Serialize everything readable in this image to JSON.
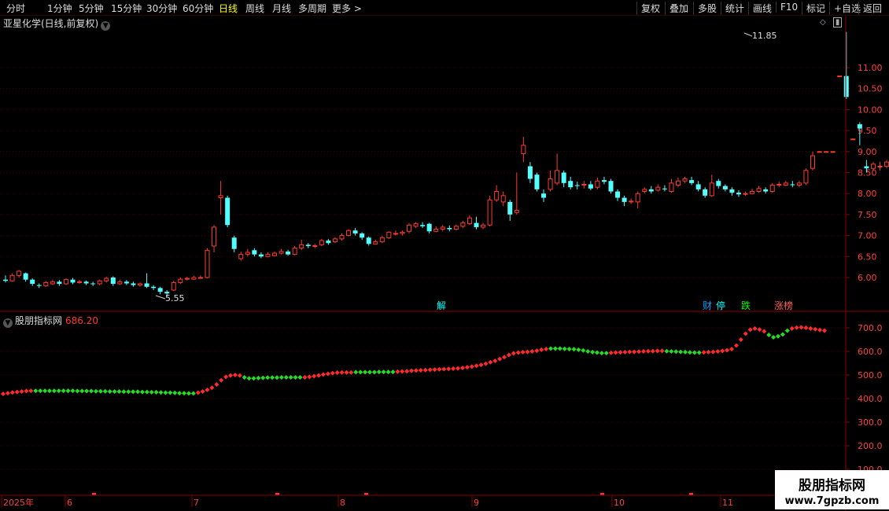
{
  "toolbar": {
    "periods": [
      "分时",
      "1分钟",
      "5分钟",
      "15分钟",
      "30分钟",
      "60分钟",
      "日线",
      "周线",
      "月线",
      "多周期",
      "更多 >"
    ],
    "active_period": "日线",
    "actions": [
      "复权",
      "叠加",
      "多股",
      "统计",
      "画线",
      "F10",
      "标记",
      "+自选",
      "返回"
    ]
  },
  "main_chart": {
    "title": "亚星化学(日线,前复权)",
    "high_label": "11.85",
    "low_label": "5.55",
    "y_ticks": [
      "11.00",
      "10.50",
      "10.00",
      "9.50",
      "9.00",
      "8.50",
      "8.00",
      "7.50",
      "7.00",
      "6.50",
      "6.00"
    ],
    "event_markers": [
      {
        "label": "解",
        "color": "#00ffff"
      },
      {
        "label": "财",
        "color": "#00a0ff"
      },
      {
        "label": "停",
        "color": "#00ffff"
      },
      {
        "label": "跌",
        "color": "#00ff00"
      },
      {
        "label": "涨榜",
        "color": "#ff6060"
      }
    ]
  },
  "indicator": {
    "title": "股朋指标网",
    "value": "686.20",
    "y_ticks": [
      "700.0",
      "600.0",
      "500.0",
      "400.0",
      "300.0",
      "200.0",
      "100.0"
    ]
  },
  "x_axis": {
    "labels": [
      "2025年",
      "6",
      "7",
      "8",
      "9",
      "10",
      "11"
    ]
  },
  "watermark": {
    "line1": "股朋指标网",
    "line2": "www.7gpzb.com"
  },
  "colors": {
    "up": "#ff3b30",
    "down": "#54ffff",
    "grid": "#4a0000",
    "axis": "#8b0000",
    "ind_up": "#ff2a2a",
    "ind_down": "#22dd22"
  },
  "chart_data": {
    "type": "candlestick",
    "ylim": [
      5.5,
      11.9
    ],
    "candles": [
      [
        5.95,
        5.92,
        6.05,
        5.88
      ],
      [
        5.92,
        6.05,
        6.1,
        5.9
      ],
      [
        6.05,
        6.15,
        6.18,
        6.0
      ],
      [
        6.1,
        5.95,
        6.12,
        5.9
      ],
      [
        5.95,
        5.85,
        5.98,
        5.8
      ],
      [
        5.82,
        5.8,
        5.86,
        5.75
      ],
      [
        5.8,
        5.88,
        5.92,
        5.78
      ],
      [
        5.85,
        5.9,
        5.95,
        5.82
      ],
      [
        5.9,
        5.85,
        5.94,
        5.8
      ],
      [
        5.85,
        5.95,
        5.98,
        5.82
      ],
      [
        5.95,
        5.88,
        5.99,
        5.84
      ],
      [
        5.88,
        5.9,
        5.94,
        5.85
      ],
      [
        5.9,
        5.86,
        5.93,
        5.82
      ],
      [
        5.86,
        5.85,
        5.9,
        5.8
      ],
      [
        5.85,
        5.92,
        5.95,
        5.82
      ],
      [
        5.92,
        5.98,
        6.02,
        5.88
      ],
      [
        6.0,
        5.85,
        6.03,
        5.8
      ],
      [
        5.85,
        5.9,
        5.95,
        5.82
      ],
      [
        5.9,
        5.86,
        5.94,
        5.82
      ],
      [
        5.86,
        5.82,
        5.9,
        5.78
      ],
      [
        5.82,
        5.85,
        5.88,
        5.78
      ],
      [
        5.86,
        5.78,
        6.1,
        5.75
      ],
      [
        5.78,
        5.75,
        5.82,
        5.7
      ],
      [
        5.75,
        5.66,
        5.78,
        5.6
      ],
      [
        5.66,
        5.62,
        5.7,
        5.55
      ],
      [
        5.7,
        5.88,
        5.92,
        5.68
      ],
      [
        5.88,
        5.96,
        6.0,
        5.85
      ],
      [
        5.96,
        5.98,
        6.02,
        5.93
      ],
      [
        5.96,
        6.0,
        6.04,
        5.94
      ],
      [
        6.0,
        6.0,
        6.05,
        5.97
      ],
      [
        6.0,
        6.65,
        6.7,
        5.98
      ],
      [
        6.75,
        7.2,
        7.25,
        6.6
      ],
      [
        7.9,
        7.95,
        8.3,
        7.5
      ],
      [
        7.9,
        7.25,
        7.95,
        7.2
      ],
      [
        6.95,
        6.68,
        7.0,
        6.6
      ],
      [
        6.45,
        6.55,
        6.62,
        6.4
      ],
      [
        6.55,
        6.6,
        6.68,
        6.5
      ],
      [
        6.65,
        6.55,
        6.7,
        6.5
      ],
      [
        6.55,
        6.5,
        6.6,
        6.46
      ],
      [
        6.5,
        6.55,
        6.6,
        6.48
      ],
      [
        6.52,
        6.58,
        6.62,
        6.5
      ],
      [
        6.58,
        6.62,
        6.68,
        6.55
      ],
      [
        6.62,
        6.55,
        6.66,
        6.52
      ],
      [
        6.55,
        6.7,
        6.75,
        6.53
      ],
      [
        6.7,
        6.78,
        6.9,
        6.65
      ],
      [
        6.78,
        6.75,
        6.82,
        6.7
      ],
      [
        6.75,
        6.76,
        6.8,
        6.7
      ],
      [
        6.78,
        6.88,
        6.92,
        6.75
      ],
      [
        6.88,
        6.82,
        6.92,
        6.78
      ],
      [
        6.85,
        6.92,
        6.96,
        6.82
      ],
      [
        6.92,
        7.0,
        7.05,
        6.88
      ],
      [
        7.0,
        7.12,
        7.15,
        6.98
      ],
      [
        7.12,
        7.05,
        7.18,
        7.0
      ],
      [
        7.05,
        6.95,
        7.08,
        6.9
      ],
      [
        6.95,
        6.8,
        6.98,
        6.76
      ],
      [
        6.8,
        6.85,
        6.9,
        6.78
      ],
      [
        6.85,
        6.95,
        7.0,
        6.82
      ],
      [
        6.95,
        7.08,
        7.1,
        6.92
      ],
      [
        7.05,
        7.05,
        7.12,
        7.0
      ],
      [
        7.05,
        7.08,
        7.12,
        7.0
      ],
      [
        7.1,
        7.25,
        7.3,
        7.05
      ],
      [
        7.22,
        7.28,
        7.32,
        7.18
      ],
      [
        7.25,
        7.22,
        7.32,
        7.18
      ],
      [
        7.28,
        7.1,
        7.3,
        7.05
      ],
      [
        7.1,
        7.15,
        7.22,
        7.08
      ],
      [
        7.15,
        7.2,
        7.25,
        7.1
      ],
      [
        7.18,
        7.15,
        7.24,
        7.1
      ],
      [
        7.15,
        7.22,
        7.26,
        7.12
      ],
      [
        7.22,
        7.3,
        7.35,
        7.18
      ],
      [
        7.28,
        7.42,
        7.48,
        7.25
      ],
      [
        7.3,
        7.2,
        7.45,
        7.15
      ],
      [
        7.2,
        7.25,
        7.3,
        7.15
      ],
      [
        7.25,
        7.85,
        7.95,
        7.22
      ],
      [
        7.85,
        8.05,
        8.2,
        7.8
      ],
      [
        7.8,
        7.95,
        8.05,
        7.7
      ],
      [
        7.8,
        7.5,
        7.85,
        7.35
      ],
      [
        7.55,
        7.6,
        8.5,
        7.5
      ],
      [
        8.95,
        9.15,
        9.35,
        8.75
      ],
      [
        8.65,
        8.35,
        8.75,
        8.25
      ],
      [
        8.45,
        8.1,
        8.5,
        8.05
      ],
      [
        8.0,
        7.9,
        8.1,
        7.8
      ],
      [
        8.1,
        8.35,
        8.55,
        8.05
      ],
      [
        8.25,
        8.55,
        8.95,
        8.2
      ],
      [
        8.5,
        8.25,
        8.55,
        8.15
      ],
      [
        8.3,
        8.15,
        8.4,
        8.1
      ],
      [
        8.2,
        8.18,
        8.28,
        8.1
      ],
      [
        8.2,
        8.22,
        8.3,
        8.12
      ],
      [
        8.22,
        8.12,
        8.3,
        8.08
      ],
      [
        8.15,
        8.3,
        8.38,
        8.1
      ],
      [
        8.32,
        8.28,
        8.4,
        8.22
      ],
      [
        8.3,
        8.05,
        8.35,
        8.0
      ],
      [
        8.05,
        7.9,
        8.1,
        7.82
      ],
      [
        7.9,
        7.8,
        7.95,
        7.7
      ],
      [
        7.8,
        7.82,
        7.88,
        7.75
      ],
      [
        7.8,
        8.0,
        8.05,
        7.65
      ],
      [
        8.05,
        8.1,
        8.15,
        8.0
      ],
      [
        8.1,
        8.05,
        8.18,
        8.0
      ],
      [
        8.08,
        8.15,
        8.22,
        8.05
      ],
      [
        8.12,
        8.1,
        8.2,
        8.05
      ],
      [
        8.05,
        8.25,
        8.35,
        8.02
      ],
      [
        8.2,
        8.3,
        8.38,
        8.15
      ],
      [
        8.3,
        8.35,
        8.4,
        8.25
      ],
      [
        8.32,
        8.25,
        8.4,
        8.2
      ],
      [
        8.22,
        8.1,
        8.3,
        8.05
      ],
      [
        8.1,
        7.95,
        8.15,
        7.9
      ],
      [
        7.95,
        8.25,
        8.45,
        7.92
      ],
      [
        8.3,
        8.18,
        8.35,
        8.12
      ],
      [
        8.18,
        8.1,
        8.22,
        8.05
      ],
      [
        8.1,
        8.02,
        8.15,
        7.95
      ],
      [
        8.02,
        7.98,
        8.08,
        7.92
      ],
      [
        8.0,
        8.0,
        8.05,
        7.95
      ],
      [
        8.0,
        8.05,
        8.12,
        7.98
      ],
      [
        8.05,
        8.12,
        8.18,
        8.02
      ],
      [
        8.1,
        8.05,
        8.15,
        8.0
      ],
      [
        8.05,
        8.2,
        8.25,
        8.02
      ],
      [
        8.2,
        8.22,
        8.28,
        8.15
      ],
      [
        8.2,
        8.25,
        8.3,
        8.18
      ],
      [
        8.22,
        8.2,
        8.3,
        8.15
      ],
      [
        8.2,
        8.25,
        8.3,
        8.15
      ],
      [
        8.25,
        8.55,
        8.6,
        8.2
      ],
      [
        8.6,
        8.9,
        9.0,
        8.55
      ],
      [
        9.0,
        9.0,
        9.0,
        9.0
      ],
      [
        9.0,
        9.0,
        9.0,
        9.0
      ],
      [
        9.0,
        9.0,
        9.0,
        9.0
      ],
      [
        10.8,
        10.8,
        10.8,
        10.8
      ],
      [
        10.8,
        10.3,
        11.85,
        10.25
      ],
      [
        9.3,
        9.3,
        9.3,
        9.3
      ],
      [
        9.65,
        9.55,
        9.7,
        9.15
      ],
      [
        8.65,
        8.6,
        8.8,
        8.5
      ],
      [
        8.6,
        8.7,
        8.75,
        8.55
      ],
      [
        8.65,
        8.65,
        8.75,
        8.55
      ],
      [
        8.65,
        8.75,
        8.8,
        8.6
      ],
      [
        8.65,
        8.95,
        9.0,
        8.6
      ],
      [
        8.95,
        9.7,
        9.8,
        8.9
      ],
      [
        9.8,
        9.6,
        10.45,
        9.55
      ],
      [
        9.6,
        9.45,
        9.65,
        9.35
      ],
      [
        9.45,
        9.4,
        9.6,
        9.3
      ],
      [
        9.4,
        9.55,
        9.9,
        9.35
      ],
      [
        9.5,
        9.35,
        9.55,
        9.05
      ],
      [
        9.3,
        9.15,
        9.35,
        9.1
      ],
      [
        9.1,
        9.12,
        9.18,
        9.0
      ]
    ],
    "indicator_series": [
      [
        420,
        1
      ],
      [
        423,
        1
      ],
      [
        426,
        1
      ],
      [
        428,
        1
      ],
      [
        430,
        1
      ],
      [
        432,
        1
      ],
      [
        433,
        1
      ],
      [
        433,
        0
      ],
      [
        433,
        0
      ],
      [
        433,
        0
      ],
      [
        433,
        0
      ],
      [
        433,
        0
      ],
      [
        433,
        0
      ],
      [
        433,
        0
      ],
      [
        433,
        0
      ],
      [
        433,
        0
      ],
      [
        432,
        0
      ],
      [
        432,
        0
      ],
      [
        432,
        0
      ],
      [
        432,
        0
      ],
      [
        431,
        0
      ],
      [
        431,
        0
      ],
      [
        431,
        0
      ],
      [
        430,
        0
      ],
      [
        430,
        0
      ],
      [
        430,
        0
      ],
      [
        429,
        0
      ],
      [
        429,
        0
      ],
      [
        429,
        0
      ],
      [
        429,
        0
      ],
      [
        428,
        0
      ],
      [
        428,
        0
      ],
      [
        427,
        0
      ],
      [
        427,
        0
      ],
      [
        426,
        0
      ],
      [
        425,
        0
      ],
      [
        425,
        0
      ],
      [
        424,
        0
      ],
      [
        423,
        0
      ],
      [
        423,
        0
      ],
      [
        422,
        0
      ],
      [
        422,
        0
      ],
      [
        425,
        1
      ],
      [
        430,
        1
      ],
      [
        437,
        1
      ],
      [
        446,
        1
      ],
      [
        460,
        1
      ],
      [
        478,
        1
      ],
      [
        492,
        1
      ],
      [
        498,
        1
      ],
      [
        500,
        1
      ],
      [
        498,
        1
      ],
      [
        490,
        0
      ],
      [
        486,
        0
      ],
      [
        486,
        0
      ],
      [
        487,
        0
      ],
      [
        488,
        0
      ],
      [
        489,
        0
      ],
      [
        489,
        0
      ],
      [
        489,
        0
      ],
      [
        490,
        0
      ],
      [
        490,
        0
      ],
      [
        490,
        0
      ],
      [
        490,
        0
      ],
      [
        490,
        0
      ],
      [
        490,
        1
      ],
      [
        492,
        1
      ],
      [
        495,
        1
      ],
      [
        498,
        1
      ],
      [
        502,
        1
      ],
      [
        505,
        1
      ],
      [
        508,
        1
      ],
      [
        510,
        1
      ],
      [
        511,
        1
      ],
      [
        511,
        1
      ],
      [
        511,
        1
      ],
      [
        512,
        0
      ],
      [
        512,
        0
      ],
      [
        512,
        0
      ],
      [
        512,
        0
      ],
      [
        512,
        0
      ],
      [
        513,
        0
      ],
      [
        513,
        0
      ],
      [
        513,
        0
      ],
      [
        513,
        0
      ],
      [
        514,
        1
      ],
      [
        515,
        1
      ],
      [
        516,
        1
      ],
      [
        518,
        1
      ],
      [
        519,
        1
      ],
      [
        520,
        1
      ],
      [
        521,
        1
      ],
      [
        522,
        1
      ],
      [
        523,
        1
      ],
      [
        524,
        1
      ],
      [
        525,
        1
      ],
      [
        526,
        1
      ],
      [
        527,
        1
      ],
      [
        528,
        1
      ],
      [
        530,
        1
      ],
      [
        533,
        1
      ],
      [
        536,
        1
      ],
      [
        539,
        1
      ],
      [
        543,
        1
      ],
      [
        548,
        1
      ],
      [
        554,
        1
      ],
      [
        560,
        1
      ],
      [
        568,
        1
      ],
      [
        576,
        1
      ],
      [
        585,
        1
      ],
      [
        592,
        1
      ],
      [
        595,
        1
      ],
      [
        597,
        1
      ],
      [
        598,
        1
      ],
      [
        600,
        1
      ],
      [
        603,
        1
      ],
      [
        607,
        1
      ],
      [
        610,
        1
      ],
      [
        612,
        0
      ],
      [
        612,
        0
      ],
      [
        612,
        0
      ],
      [
        611,
        0
      ],
      [
        610,
        0
      ],
      [
        609,
        0
      ],
      [
        607,
        0
      ],
      [
        604,
        0
      ],
      [
        600,
        0
      ],
      [
        597,
        0
      ],
      [
        595,
        0
      ],
      [
        593,
        0
      ],
      [
        593,
        0
      ],
      [
        594,
        1
      ],
      [
        595,
        1
      ],
      [
        596,
        1
      ],
      [
        597,
        1
      ],
      [
        598,
        1
      ],
      [
        598,
        1
      ],
      [
        599,
        1
      ],
      [
        600,
        1
      ],
      [
        601,
        1
      ],
      [
        601,
        1
      ],
      [
        602,
        1
      ],
      [
        602,
        1
      ],
      [
        601,
        0
      ],
      [
        600,
        0
      ],
      [
        599,
        0
      ],
      [
        598,
        0
      ],
      [
        597,
        0
      ],
      [
        596,
        0
      ],
      [
        595,
        0
      ],
      [
        595,
        0
      ],
      [
        596,
        1
      ],
      [
        597,
        1
      ],
      [
        598,
        1
      ],
      [
        600,
        1
      ],
      [
        602,
        1
      ],
      [
        605,
        1
      ],
      [
        610,
        1
      ],
      [
        625,
        1
      ],
      [
        650,
        1
      ],
      [
        675,
        1
      ],
      [
        692,
        1
      ],
      [
        697,
        1
      ],
      [
        693,
        1
      ],
      [
        685,
        1
      ],
      [
        670,
        0
      ],
      [
        660,
        0
      ],
      [
        664,
        0
      ],
      [
        672,
        0
      ],
      [
        688,
        0
      ],
      [
        697,
        1
      ],
      [
        701,
        1
      ],
      [
        702,
        1
      ],
      [
        700,
        1
      ],
      [
        697,
        1
      ],
      [
        694,
        1
      ],
      [
        691,
        1
      ],
      [
        688,
        1
      ]
    ]
  }
}
